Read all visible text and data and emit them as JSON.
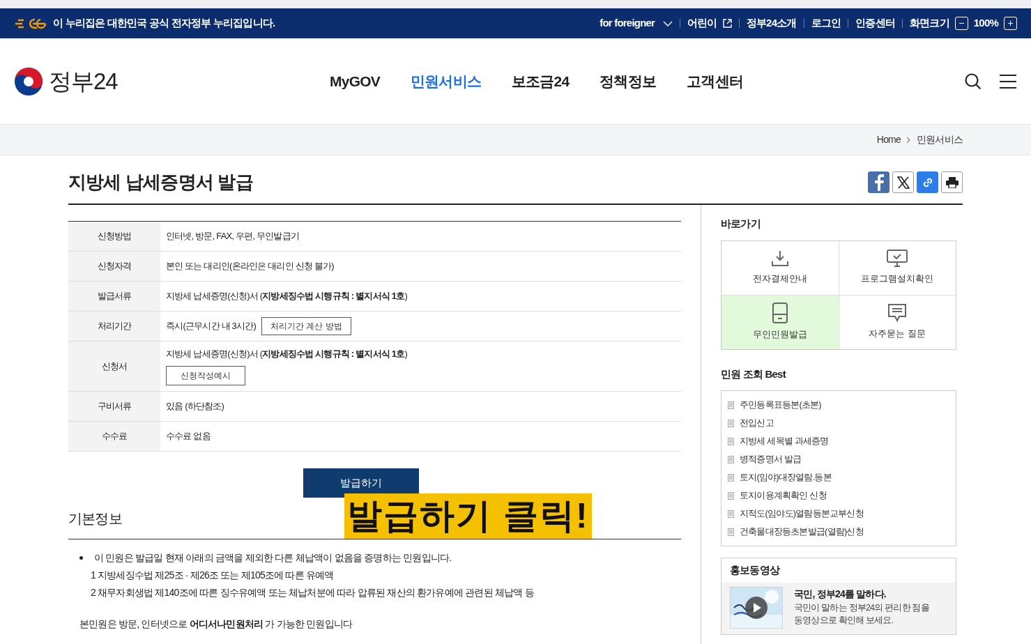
{
  "gov_banner": {
    "text": "이 누리집은 대한민국 공식 전자정부 누리집입니다.",
    "links": [
      {
        "label": "for foreigner",
        "kind": "dropdown"
      },
      {
        "label": "어린이",
        "kind": "external"
      },
      {
        "label": "정부24소개",
        "kind": "plain"
      },
      {
        "label": "로그인",
        "kind": "plain"
      },
      {
        "label": "인증센터",
        "kind": "plain"
      }
    ],
    "zoom": {
      "label": "화면크기",
      "decrease": "−",
      "value": "100%",
      "increase": "+"
    }
  },
  "header": {
    "logo_text": "정부24",
    "nav": [
      {
        "label": "MyGOV",
        "selected": false
      },
      {
        "label": "민원서비스",
        "selected": true
      },
      {
        "label": "보조금24",
        "selected": false
      },
      {
        "label": "정책정보",
        "selected": false
      },
      {
        "label": "고객센터",
        "selected": false
      }
    ]
  },
  "breadcrumb": [
    "Home",
    "민원서비스"
  ],
  "page_title": "지방세 납세증명서 발급",
  "info_table": [
    {
      "kind": "text",
      "label": "신청방법",
      "value": "인터넷, 방문, FAX, 우편, 무인발급기"
    },
    {
      "kind": "text",
      "label": "신청자격",
      "value": "본인 또는 대리인(온라인은 대리인 신청 불가)"
    },
    {
      "kind": "text",
      "label": "발급서류",
      "value": "지방세 납세증명(신청)서 (**지방세징수법 시행규칙 : 별지서식 1호**)"
    },
    {
      "kind": "inline",
      "label": "처리기간",
      "value": "즉시(근무시간 내 3시간)",
      "button": "처리기간 계산 방법"
    },
    {
      "kind": "below",
      "label": "신청서",
      "value": "지방세 납세증명(신청)서 (**지방세징수법 시행규칙 : 별지서식 1호**)",
      "button": "신청작성예시"
    },
    {
      "kind": "text",
      "label": "구비서류",
      "value": "있음 (하단참조)"
    },
    {
      "kind": "text",
      "label": "수수료",
      "value": "수수료 없음"
    }
  ],
  "issue_button": "발급하기",
  "callout": "발급하기 클릭!",
  "basic_info": {
    "heading": "기본정보",
    "bullet": "이 민원은 발급일 현재 아래의 금액을 제외한 다른 체납액이 없음을 증명하는 민원입니다.",
    "sub_items": [
      "1 지방세징수법 제25조 · 제26조 또는 제105조에 따른 유예액",
      "2 채무자회생법 제140조에 따른 징수유예액 또는 체납처분에 따라 압류된 재산의 환가유예에 관련된 체납액 등"
    ],
    "note": "본민원은 방문, 인터넷으로 **어디서나민원처리** 가 가능한 민원입니다"
  },
  "quick_links": {
    "heading": "바로가기",
    "items": [
      {
        "label": "전자결제안내",
        "selected": false
      },
      {
        "label": "프로그램설치확인",
        "selected": false
      },
      {
        "label": "무인민원발급",
        "selected": true
      },
      {
        "label": "자주묻는 질문",
        "selected": false
      }
    ]
  },
  "best": {
    "heading": "민원 조회 Best",
    "items": [
      "주민등록표등본(초본)",
      "전입신고",
      "지방세 세목별 과세증명",
      "병적증명서 발급",
      "토지(임야)대장열람.등본",
      "토지이용계획확인 신청",
      "지적도(임야도)열람등본교부신청",
      "건축물대장등초본발급(열람)신청"
    ]
  },
  "video": {
    "heading": "홍보동영상",
    "title": "국민, 정부24를 말하다.",
    "description": "국민이 말하는 정부24의 편리한 점을\n동영상으로 확인해 보세요."
  }
}
